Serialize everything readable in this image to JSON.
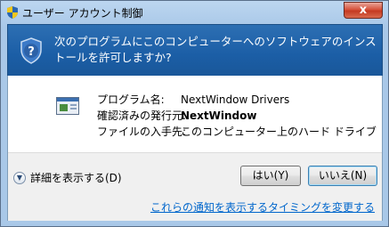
{
  "window": {
    "title": "ユーザー アカウント制御",
    "close_label": "x"
  },
  "header": {
    "message": "次のプログラムにこのコンピューターへのソフトウェアのインストールを許可しますか?"
  },
  "program": {
    "name_label": "プログラム名:",
    "name_value": "NextWindow Drivers",
    "publisher_label": "確認済みの発行元:",
    "publisher_value": "NextWindow",
    "origin_label": "ファイルの入手先:",
    "origin_value": "このコンピューター上のハード ドライブ"
  },
  "footer": {
    "details_label": "詳細を表示する(D)",
    "yes_label": "はい(Y)",
    "no_label": "いいえ(N)",
    "notify_link": "これらの通知を表示するタイミングを変更する"
  },
  "colors": {
    "header_blue": "#1b5ea6",
    "link_blue": "#0066cc",
    "close_red": "#c43a22"
  }
}
